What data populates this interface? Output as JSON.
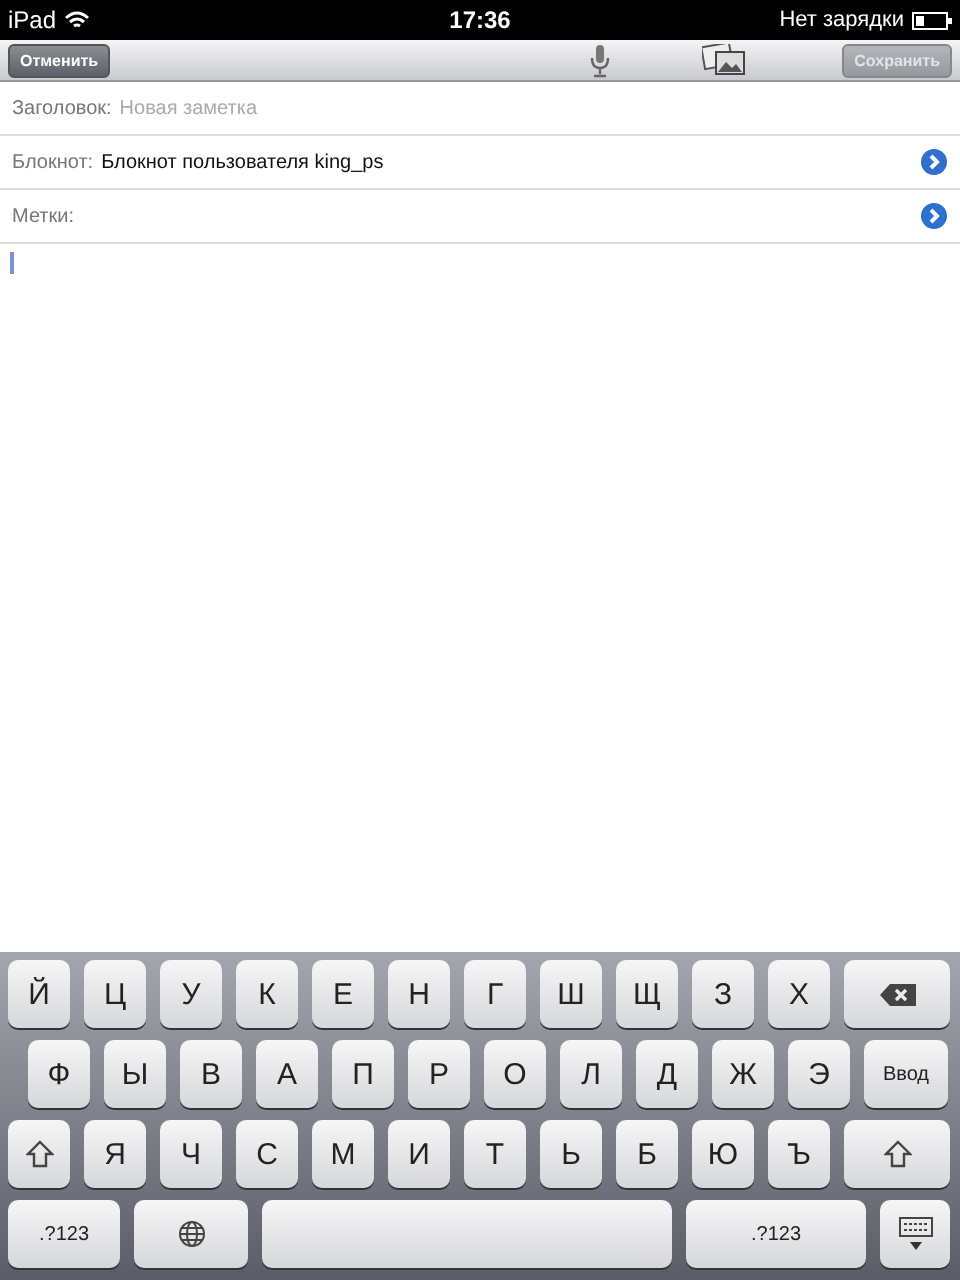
{
  "status_bar": {
    "device": "iPad",
    "time": "17:36",
    "charging": "Нет зарядки"
  },
  "toolbar": {
    "cancel": {
      "label": "Отменить",
      "disabled": false
    },
    "save": {
      "label": "Сохранить",
      "disabled": true
    }
  },
  "fields": [
    {
      "label": "Заголовок:",
      "placeholder": "Новая заметка",
      "detail": false
    },
    {
      "label": "Блокнот:",
      "value": "Блокнот пользователя king_ps",
      "detail": true
    },
    {
      "label": "Метки:",
      "detail": true
    }
  ],
  "keyboard": {
    "rows": [
      [
        {
          "kind": "letter",
          "label": "Й"
        },
        {
          "kind": "letter",
          "label": "Ц"
        },
        {
          "kind": "letter",
          "label": "У"
        },
        {
          "kind": "letter",
          "label": "К"
        },
        {
          "kind": "letter",
          "label": "Е"
        },
        {
          "kind": "letter",
          "label": "Н"
        },
        {
          "kind": "letter",
          "label": "Г"
        },
        {
          "kind": "letter",
          "label": "Ш"
        },
        {
          "kind": "letter",
          "label": "Щ"
        },
        {
          "kind": "letter",
          "label": "З"
        },
        {
          "kind": "letter",
          "label": "Х"
        },
        {
          "kind": "backspace"
        }
      ],
      [
        {
          "kind": "letter",
          "label": "Ф"
        },
        {
          "kind": "letter",
          "label": "Ы"
        },
        {
          "kind": "letter",
          "label": "В"
        },
        {
          "kind": "letter",
          "label": "А"
        },
        {
          "kind": "letter",
          "label": "П"
        },
        {
          "kind": "letter",
          "label": "Р"
        },
        {
          "kind": "letter",
          "label": "О"
        },
        {
          "kind": "letter",
          "label": "Л"
        },
        {
          "kind": "letter",
          "label": "Д"
        },
        {
          "kind": "letter",
          "label": "Ж"
        },
        {
          "kind": "letter",
          "label": "Э"
        },
        {
          "kind": "enter",
          "label": "Ввод"
        }
      ],
      [
        {
          "kind": "shift"
        },
        {
          "kind": "letter",
          "label": "Я"
        },
        {
          "kind": "letter",
          "label": "Ч"
        },
        {
          "kind": "letter",
          "label": "С"
        },
        {
          "kind": "letter",
          "label": "М"
        },
        {
          "kind": "letter",
          "label": "И"
        },
        {
          "kind": "letter",
          "label": "Т"
        },
        {
          "kind": "letter",
          "label": "Ь"
        },
        {
          "kind": "letter",
          "label": "Б"
        },
        {
          "kind": "letter",
          "label": "Ю"
        },
        {
          "kind": "letter",
          "label": "Ъ"
        },
        {
          "kind": "shift"
        }
      ],
      [
        {
          "kind": "numbers",
          "label": ".?123"
        },
        {
          "kind": "globe"
        },
        {
          "kind": "space"
        },
        {
          "kind": "numbers",
          "label": ".?123",
          "wide": true
        },
        {
          "kind": "hide"
        }
      ]
    ]
  }
}
